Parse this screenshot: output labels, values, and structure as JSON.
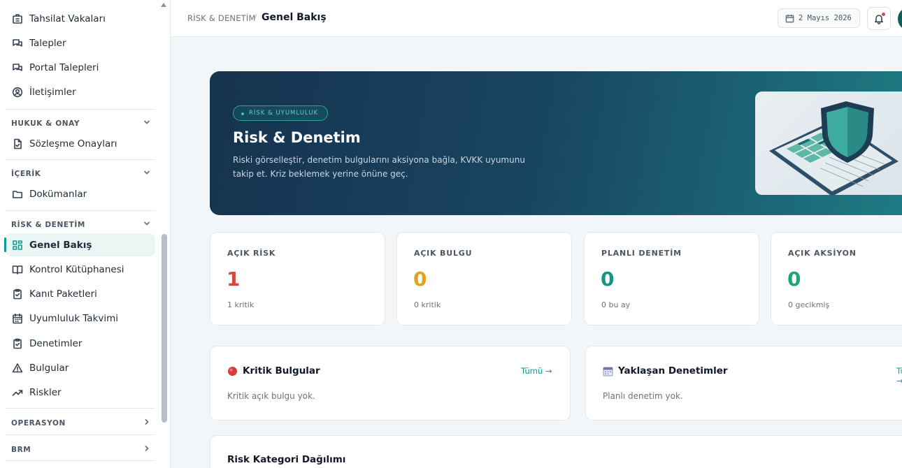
{
  "sidebar": {
    "items_top": [
      {
        "label": "Tahsilat Vakaları",
        "icon": "building-icon"
      },
      {
        "label": "Talepler",
        "icon": "chat-icon"
      },
      {
        "label": "Portal Talepleri",
        "icon": "chat-icon"
      },
      {
        "label": "İletişimler",
        "icon": "user-circle-icon"
      }
    ],
    "sections": [
      {
        "label": "HUKUK & ONAY",
        "items": [
          {
            "label": "Sözleşme Onayları",
            "icon": "file-check-icon"
          }
        ]
      },
      {
        "label": "İÇERİK",
        "items": [
          {
            "label": "Dokümanlar",
            "icon": "folder-icon"
          }
        ]
      },
      {
        "label": "RİSK & DENETİM",
        "items": [
          {
            "label": "Genel Bakış",
            "icon": "grid-icon",
            "active": true
          },
          {
            "label": "Kontrol Kütüphanesi",
            "icon": "book-icon"
          },
          {
            "label": "Kanıt Paketleri",
            "icon": "clipboard-icon"
          },
          {
            "label": "Uyumluluk Takvimi",
            "icon": "calendar-icon"
          },
          {
            "label": "Denetimler",
            "icon": "clipboard-check-icon"
          },
          {
            "label": "Bulgular",
            "icon": "alert-triangle-icon"
          },
          {
            "label": "Riskler",
            "icon": "trending-up-icon"
          }
        ]
      },
      {
        "label": "OPERASYON"
      },
      {
        "label": "BRM"
      }
    ]
  },
  "topbar": {
    "breadcrumb_parent": "RİSK & DENETİM",
    "breadcrumb_sep": "/",
    "breadcrumb_current": "Genel Bakış",
    "date": "2 Mayıs 2026"
  },
  "hero": {
    "badge": "RİSK & UYUMLULUK",
    "title": "Risk & Denetim",
    "description": "Riski görselleştir, denetim bulgularını aksiyona bağla, KVKK uyumunu takip et. Kriz beklemek yerine önüne geç."
  },
  "stats": [
    {
      "label": "AÇIK RİSK",
      "value": "1",
      "sub": "1 kritik",
      "color": "#d64545"
    },
    {
      "label": "AÇIK BULGU",
      "value": "0",
      "sub": "0 kritik",
      "color": "#e0a21b"
    },
    {
      "label": "PLANLI DENETİM",
      "value": "0",
      "sub": "0 bu ay",
      "color": "#14948a"
    },
    {
      "label": "AÇIK AKSİYON",
      "value": "0",
      "sub": "0 gecikmiş",
      "color": "#1fa66f"
    }
  ],
  "panels": {
    "critical": {
      "title": "Kritik Bulgular",
      "link": "Tümü →",
      "empty": "Kritik açık bulgu yok."
    },
    "upcoming": {
      "title": "Yaklaşan Denetimler",
      "link": "Tümü →",
      "empty": "Planlı denetim yok."
    },
    "category": {
      "title": "Risk Kategori Dağılımı"
    }
  },
  "colors": {
    "accent": "#0f9b8e",
    "hero_dark": "#16334f"
  }
}
